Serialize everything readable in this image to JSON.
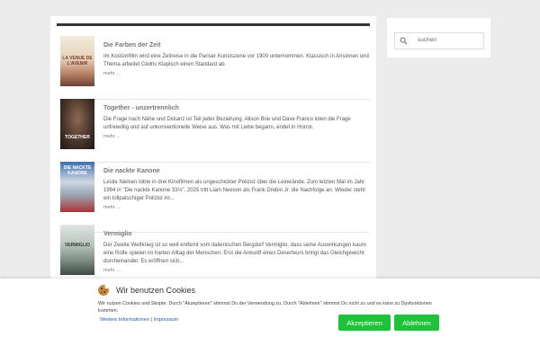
{
  "posts": [
    {
      "title": "Die Farben der Zeit",
      "excerpt": "Im Kostümfilm wird eine Zeitreise in die Pariser Kunstszene vor 1900 unternommen. Klassisch in Ansinnen und Thema arbeitet Cédric Klapisch einen Standard ab.",
      "more": "mehr ...",
      "poster_text": "LA VENUE DE L'AVENIR",
      "poster_colors": [
        "#efe4d2",
        "#c98f6f",
        "#6f4a3b"
      ]
    },
    {
      "title": "Together - unzertrennlich",
      "excerpt": "Die Frage nach Nähe und Distanz ist Teil jeder Beziehung. Alison Brie und Dave Franco loten die Frage unfreiwillig und auf unkonventionelle Weise aus. Was mit Liebe begann, endet in Horror.",
      "more": "mehr ...",
      "poster_text": "TOGETHER",
      "poster_colors": [
        "#3a2f2a",
        "#7a5c48",
        "#201814"
      ]
    },
    {
      "title": "Die nackte Kanone",
      "excerpt": "Leslie Nielsen tobte in drei Kinofilmen als ungeschickter Polizist über die Leinwände. Zum letzten Mal im Jahr 1994 in \"Die nackte Kanone 33⅓\". 2025 tritt Liam Neeson als Frank Drebin Jr. die Nachfolge an. Wieder steht ein tollpatschiger Polizist im...",
      "more": "mehr ...",
      "poster_text": "DIE NACKTE KANONE",
      "poster_colors": [
        "#2f5f99",
        "#d9dfe6",
        "#b23a3a"
      ]
    },
    {
      "title": "Vermiglio",
      "excerpt": "Der Zweite Weltkrieg ist so weit entfernt vom italienischen Bergdorf Vermiglio, dass seine Auswirkungen kaum eine Rolle spielen im harten Alltag der Menschen. Erst die Ankunft eines Deserteurs bringt das Gleichgewicht durcheinander. Es eröffnen sich...",
      "more": "mehr ...",
      "poster_text": "VERMIGLIO",
      "poster_colors": [
        "#c9d2cf",
        "#8a9a90",
        "#4d5b52"
      ]
    }
  ],
  "search": {
    "placeholder": "suchen"
  },
  "cookie_banner": {
    "title": "Wir benutzen Cookies",
    "text": "Wir nutzen Cookies und Skripte. Durch \"Akzeptieren\" stimmst Du der Verwendung zu. Durch \"Ablehnen\" stimmst Du nicht zu und es kann zu Dysfunktionen kommen.",
    "link_more": "Weitere Informationen",
    "separator": "|",
    "link_impressum": "Impressum",
    "accept_label": "Akzeptieren",
    "reject_label": "Ablehnen",
    "button_color": "#1fc23a"
  }
}
